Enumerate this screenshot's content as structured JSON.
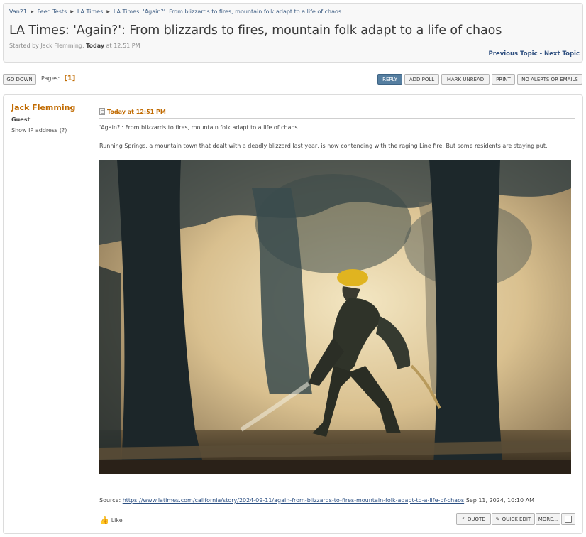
{
  "breadcrumb": [
    "Van21",
    "Feed Tests",
    "LA Times",
    "LA Times: 'Again?': From blizzards to fires, mountain folk adapt to a life of chaos"
  ],
  "topic": {
    "title": "LA Times: 'Again?': From blizzards to fires, mountain folk adapt to a life of chaos",
    "started_prefix": "Started by Jack Flemming,",
    "started_day": "Today",
    "started_time": "at 12:51 PM",
    "prev_next": "Previous Topic - Next Topic"
  },
  "toolbar": {
    "go_down": "GO DOWN",
    "pages_label": "Pages:",
    "current_page": "[1]",
    "reply": "REPLY",
    "add_poll": "ADD POLL",
    "mark_unread": "MARK UNREAD",
    "print": "PRINT",
    "no_alerts": "NO ALERTS OR EMAILS"
  },
  "post": {
    "author": "Jack Flemming",
    "group": "Guest",
    "show_ip": "Show IP address (?)",
    "time": "Today at 12:51 PM",
    "headline": "'Again?': From blizzards to fires, mountain folk adapt to a life of chaos",
    "summary": "Running Springs, a mountain town that dealt with a deadly blizzard last year, is now contending with the raging Line fire. But some residents are staying put.",
    "source_label": "Source:",
    "source_url": "https://www.latimes.com/california/story/2024-09-11/again-from-blizzards-to-fires-mountain-folk-adapt-to-a-life-of-chaos",
    "source_date": "Sep 11, 2024, 10:10 AM",
    "like": "Like",
    "quote": "QUOTE",
    "quick_edit": "QUICK EDIT",
    "more": "MORE..."
  }
}
